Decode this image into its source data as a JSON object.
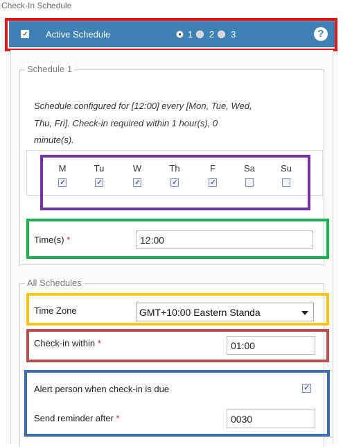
{
  "section_title": "Check-In Schedule",
  "header": {
    "active_label": "Active Schedule",
    "active_checked": true,
    "schedule_options": [
      "1",
      "2",
      "3"
    ],
    "selected_option": "1",
    "help_glyph": "?"
  },
  "schedule1": {
    "legend": "Schedule 1",
    "description_lines": [
      "Schedule configured for [12:00] every [Mon, Tue, Wed,",
      "Thu, Fri]. Check-in required within 1 hour(s), 0",
      "minute(s)."
    ],
    "days": [
      {
        "label": "M",
        "checked": true
      },
      {
        "label": "Tu",
        "checked": true
      },
      {
        "label": "W",
        "checked": true
      },
      {
        "label": "Th",
        "checked": true
      },
      {
        "label": "F",
        "checked": true
      },
      {
        "label": "Sa",
        "checked": false
      },
      {
        "label": "Su",
        "checked": false
      }
    ],
    "times_label": "Time(s)",
    "required_mark": "*",
    "times_value": "12:00"
  },
  "all_schedules": {
    "legend": "All Schedules",
    "timezone_label": "Time Zone",
    "timezone_value": "GMT+10:00 Eastern Standa",
    "checkin_within_label": "Check-in within",
    "checkin_within_value": "01:00",
    "alert_label": "Alert person when check-in is due",
    "alert_checked": true,
    "reminder_label": "Send reminder after",
    "reminder_value": "0030"
  },
  "colors": {
    "header_bar": "#3e81b4",
    "highlight_red": "#e8151e",
    "highlight_purple": "#7531a4",
    "highlight_green": "#1bb14c",
    "highlight_yellow": "#fcc419",
    "highlight_brown": "#b94d4f",
    "highlight_blue": "#3a6db1",
    "required_asterisk": "#d21f1f"
  }
}
